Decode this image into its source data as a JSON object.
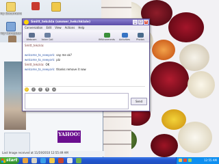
{
  "desktop_icons": [
    {
      "label": "My Documents",
      "icon": "documents-folder-icon",
      "color": "#f2d46a"
    },
    {
      "label": "",
      "icon": "application-icon",
      "color": "#c83a2e"
    },
    {
      "label": "",
      "icon": "folder-icon",
      "color": "#f0c84a"
    },
    {
      "label": "My Computer",
      "icon": "computer-icon",
      "color": "#7fa6d8"
    },
    {
      "label": "",
      "icon": "shortcut-icon",
      "color": "#9a7c5e"
    }
  ],
  "messenger": {
    "title": "Smitt_tekckla (smmer_hekchklale)",
    "menu": [
      "Conversation",
      "Edit",
      "View",
      "Actions",
      "Help"
    ],
    "toolbar": [
      {
        "label": "Webcam",
        "icon": "webcam-icon",
        "color": "#5c6f8f"
      },
      {
        "label": "Voice Call",
        "icon": "voice-call-icon",
        "color": "#6a7fa0"
      },
      {
        "label": "IMVironments",
        "icon": "imvironment-icon",
        "color": "#3b8f3b"
      },
      {
        "label": "Activities",
        "icon": "activities-icon",
        "color": "#3673c4"
      },
      {
        "label": "Photos",
        "icon": "photos-icon",
        "color": "#4a6b8c"
      }
    ],
    "messages": [
      {
        "sender": "Smitt_tekckla:",
        "text": "",
        "mine": false
      },
      {
        "sender": "",
        "text": "",
        "mine": true
      },
      {
        "sender": "welcome_to_newyork:",
        "text": "say me ok?",
        "mine": true
      },
      {
        "sender": "welcome_to_newyork:",
        "text": "plz",
        "mine": true
      },
      {
        "sender": "Smitt_tekckla:",
        "text": "OK",
        "mine": false
      },
      {
        "sender": "welcome_to_newyork:",
        "text": "thanks remove it now",
        "mine": true
      }
    ],
    "format_tools": [
      "emoticon-icon",
      "audibles-icon",
      "font-icon",
      "text-style-icon",
      "nudge-icon"
    ],
    "send_label": "Send",
    "input_value": ""
  },
  "page": {
    "ad_brand": "YAHOO!",
    "ad_sub": "",
    "status_text": "Last Image received at 11/19/2010 12:55:49 AM"
  },
  "taskbar": {
    "start_label": "start",
    "clock": "12:55 AM",
    "app_icons": [
      "#e8a33d",
      "#d9d4c2",
      "#3aa0e8",
      "#f0c84a",
      "#c9452f",
      "#e6e6e6",
      "#6fb04c"
    ]
  }
}
